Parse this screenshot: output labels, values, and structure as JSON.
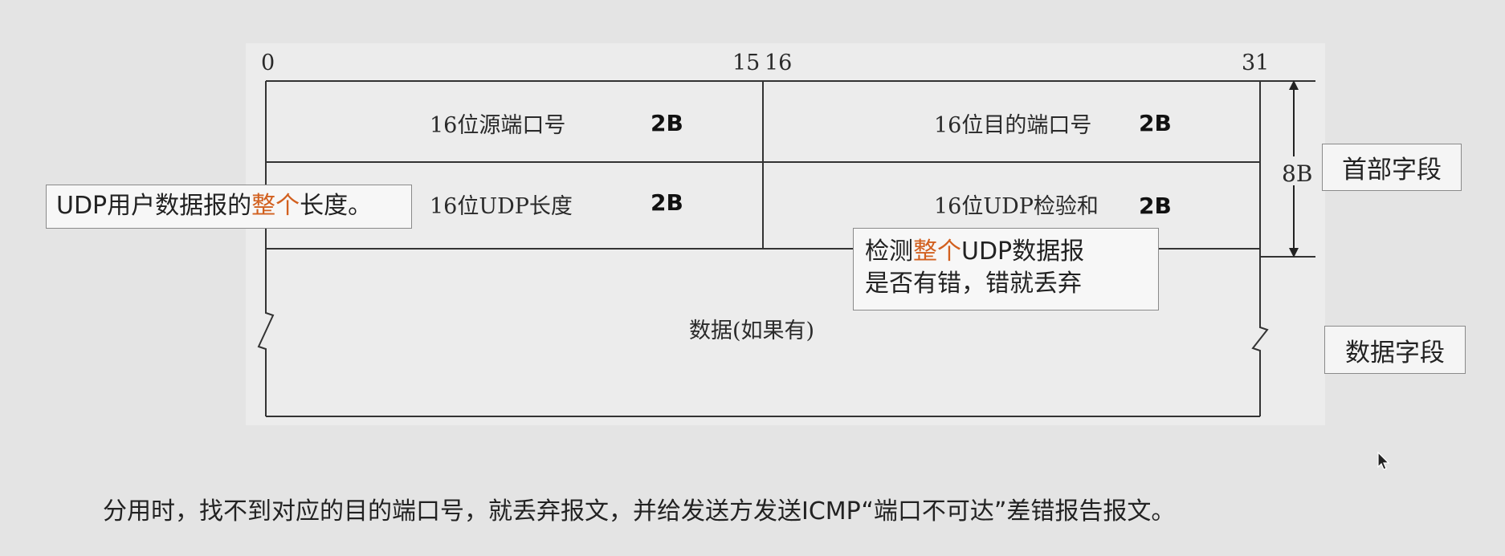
{
  "diagram": {
    "bit_labels": {
      "start": "0",
      "mid_end": "15",
      "mid_start": "16",
      "end": "31"
    },
    "fields": {
      "src_port": {
        "label": "16位源端口号",
        "size": "2B"
      },
      "dst_port": {
        "label": "16位目的端口号",
        "size": "2B"
      },
      "length": {
        "label": "16位UDP长度",
        "size": "2B"
      },
      "checksum": {
        "label": "16位UDP检验和",
        "size": "2B"
      },
      "data": {
        "label": "数据(如果有)"
      }
    },
    "header_size": "8B"
  },
  "tags": {
    "header": "首部字段",
    "data": "数据字段"
  },
  "callouts": {
    "length": {
      "pre": "UDP用户数据报的",
      "highlight": "整个",
      "post": "长度。"
    },
    "checksum": {
      "line1_pre": "检测",
      "line1_highlight": "整个",
      "line1_post": "UDP数据报",
      "line2": "是否有错，错就丢弃"
    },
    "highlight_color": "#d2601f"
  },
  "footer_note": "分用时，找不到对应的目的端口号，就丢弃报文，并给发送方发送ICMP“端口不可达”差错报告报文。"
}
